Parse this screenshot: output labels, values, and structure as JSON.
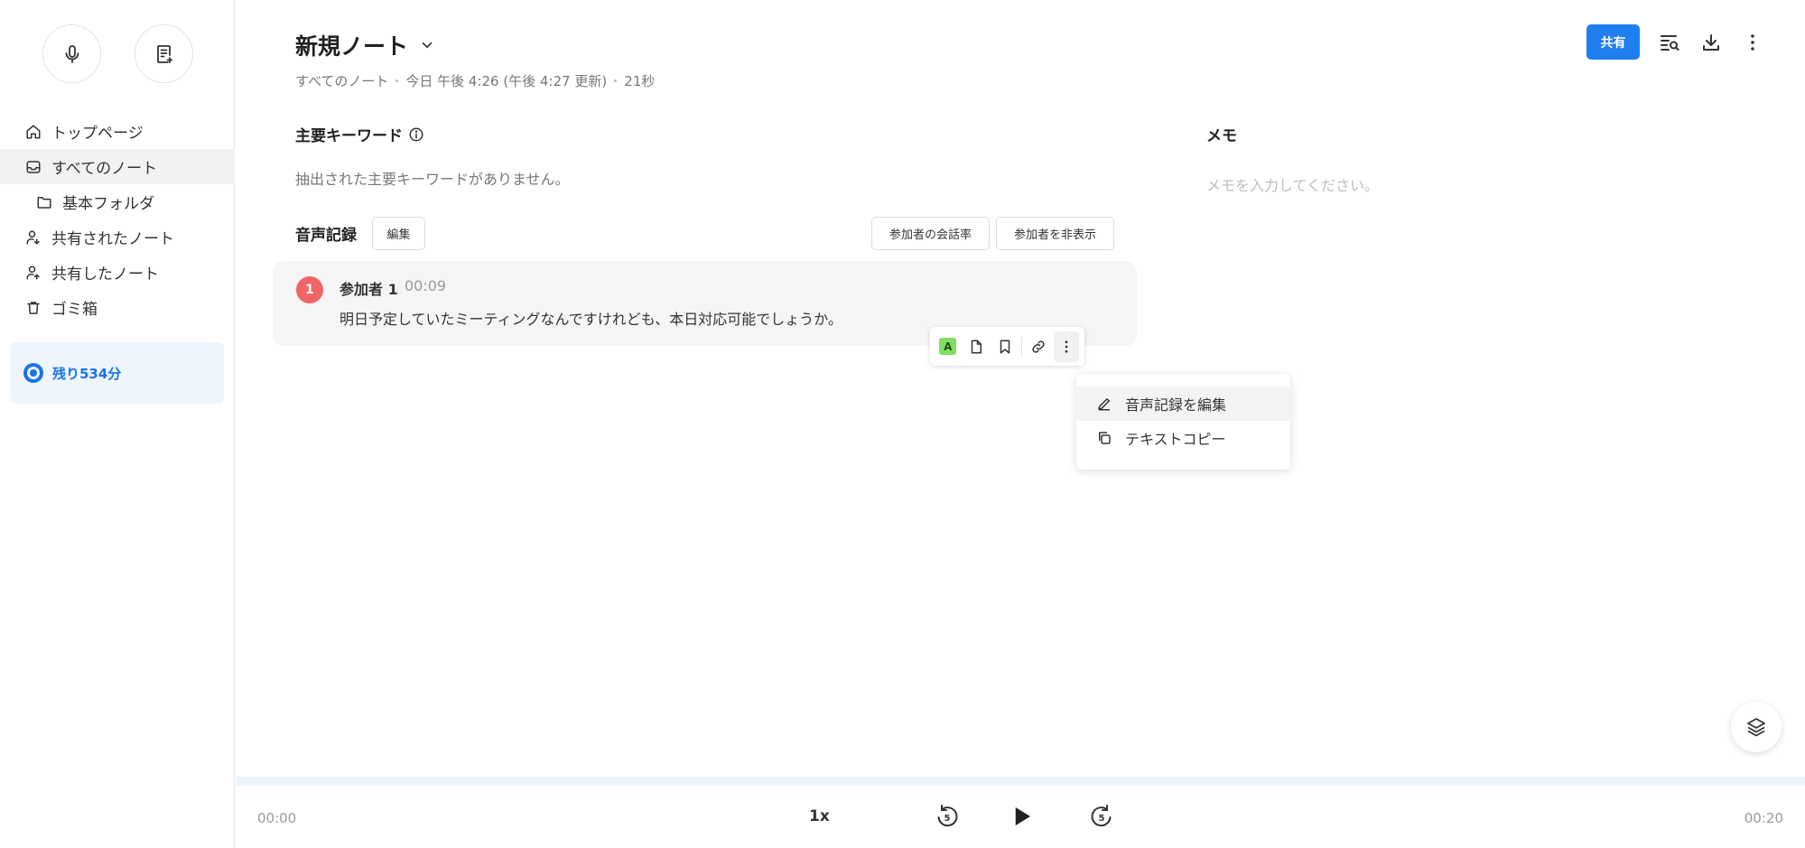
{
  "sidebar": {
    "items": [
      {
        "label": "トップページ"
      },
      {
        "label": "すべてのノート"
      },
      {
        "label": "基本フォルダ"
      },
      {
        "label": "共有されたノート"
      },
      {
        "label": "共有したノート"
      },
      {
        "label": "ゴミ箱"
      }
    ],
    "quota": {
      "label": "残り534分"
    }
  },
  "header": {
    "title": "新規ノート",
    "meta": {
      "folder": "すべてのノート",
      "date": "今日 午後 4:26 (午後 4:27 更新)",
      "duration": "21秒"
    },
    "share_label": "共有"
  },
  "keywords": {
    "title": "主要キーワード",
    "empty": "抽出された主要キーワードがありません。"
  },
  "memo": {
    "title": "メモ",
    "placeholder": "メモを入力してください。"
  },
  "recording": {
    "title": "音声記録",
    "edit_label": "編集",
    "ratio_label": "参加者の会話率",
    "hide_label": "参加者を非表示",
    "segments": [
      {
        "badge": "1",
        "speaker": "参加者 1",
        "time": "00:09",
        "text": "明日予定していたミーティングなんですけれども、本日対応可能でしょうか。"
      }
    ]
  },
  "toolbar": {
    "highlight_glyph": "A"
  },
  "context_menu": {
    "items": [
      {
        "label": "音声記録を編集",
        "icon": "pencil-icon"
      },
      {
        "label": "テキストコピー",
        "icon": "copy-icon"
      }
    ]
  },
  "player": {
    "current": "00:00",
    "total": "00:20",
    "speed": "1x",
    "skip_back": "5",
    "skip_forward": "5"
  },
  "colors": {
    "accent": "#1f7ff0",
    "badge": "#f26565",
    "highlight": "#7fe060"
  }
}
